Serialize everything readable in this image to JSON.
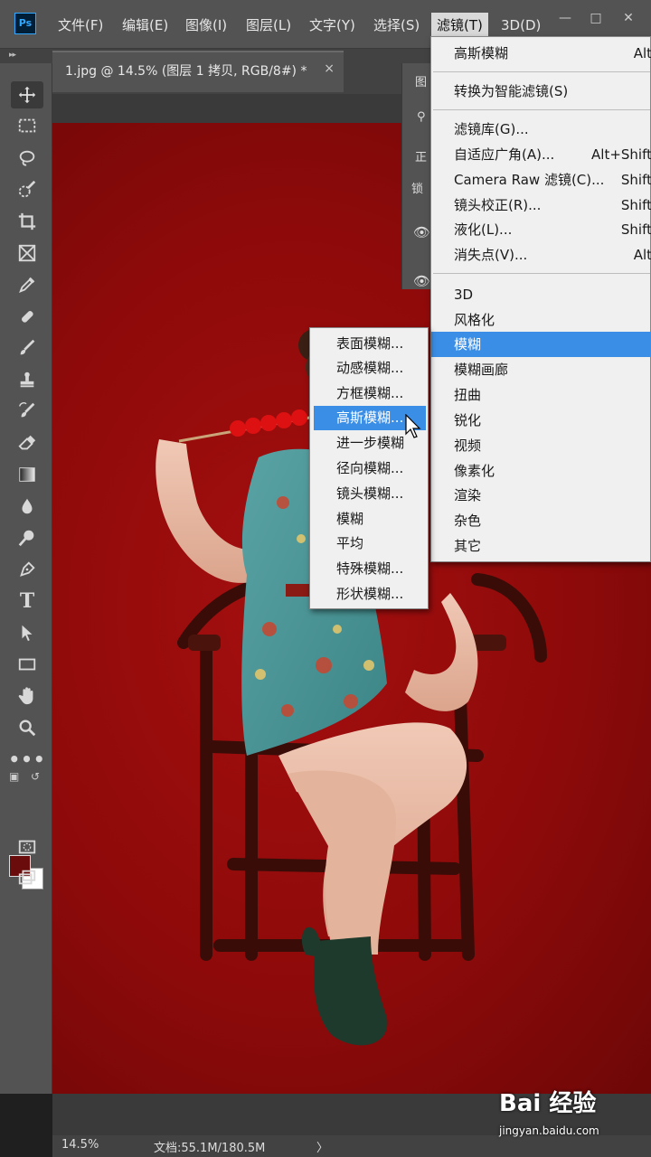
{
  "app": {
    "logo": "Ps"
  },
  "menubar": {
    "items": [
      "文件(F)",
      "编辑(E)",
      "图像(I)",
      "图层(L)",
      "文字(Y)",
      "选择(S)",
      "滤镜(T)",
      "3D(D)"
    ],
    "active": "滤镜(T)"
  },
  "document": {
    "tab_title": "1.jpg @ 14.5% (图层 1 拷贝, RGB/8#) *",
    "close": "×"
  },
  "right_panel": {
    "label1": "图",
    "label2": "正",
    "label3": "锁"
  },
  "filter_menu": {
    "items": [
      {
        "label": "高斯模糊",
        "shortcut": "Alt"
      },
      {
        "label": "转换为智能滤镜(S)",
        "shortcut": ""
      },
      {
        "label": "滤镜库(G)...",
        "shortcut": ""
      },
      {
        "label": "自适应广角(A)...",
        "shortcut": "Alt+Shift"
      },
      {
        "label": "Camera Raw 滤镜(C)...",
        "shortcut": "Shift"
      },
      {
        "label": "镜头校正(R)...",
        "shortcut": "Shift"
      },
      {
        "label": "液化(L)...",
        "shortcut": "Shift"
      },
      {
        "label": "消失点(V)...",
        "shortcut": "Alt"
      },
      {
        "label": "3D",
        "shortcut": ""
      },
      {
        "label": "风格化",
        "shortcut": ""
      },
      {
        "label": "模糊",
        "shortcut": ""
      },
      {
        "label": "模糊画廊",
        "shortcut": ""
      },
      {
        "label": "扭曲",
        "shortcut": ""
      },
      {
        "label": "锐化",
        "shortcut": ""
      },
      {
        "label": "视频",
        "shortcut": ""
      },
      {
        "label": "像素化",
        "shortcut": ""
      },
      {
        "label": "渲染",
        "shortcut": ""
      },
      {
        "label": "杂色",
        "shortcut": ""
      },
      {
        "label": "其它",
        "shortcut": ""
      }
    ],
    "highlighted": "模糊"
  },
  "blur_menu": {
    "items": [
      "表面模糊...",
      "动感模糊...",
      "方框模糊...",
      "高斯模糊...",
      "进一步模糊",
      "径向模糊...",
      "镜头模糊...",
      "模糊",
      "平均",
      "特殊模糊...",
      "形状模糊..."
    ],
    "highlighted": "高斯模糊..."
  },
  "status": {
    "zoom": "14.5%",
    "doc_size": "文档:55.1M/180.5M",
    "arrow": "〉"
  },
  "colors": {
    "foreground": "#6a0c0c",
    "background": "#ffffff",
    "highlight": "#3a8ee6"
  },
  "watermark": {
    "logo": "Bai 经验",
    "url": "jingyan.baidu.com"
  }
}
